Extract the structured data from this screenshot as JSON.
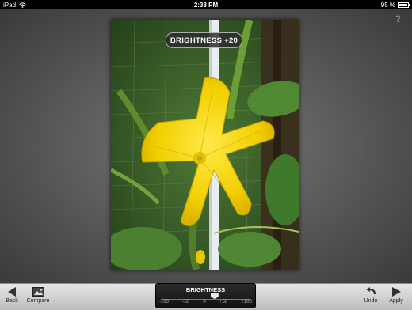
{
  "status_bar": {
    "device": "iPad",
    "time": "2:38 PM",
    "battery": "95 %"
  },
  "help": {
    "label": "?"
  },
  "photo": {
    "adjustment_badge": "BRIGHTNESS +20"
  },
  "toolbar": {
    "back_label": "Back",
    "compare_label": "Compare",
    "undo_label": "Undo",
    "apply_label": "Apply"
  },
  "slider": {
    "label": "BRIGHTNESS",
    "ticks": [
      "-100",
      "-50",
      "0",
      "+50",
      "+100"
    ],
    "value": 20,
    "min": -100,
    "max": 100
  },
  "colors": {
    "toolbar_bg": "#d4d4d4",
    "flower": "#f5d800",
    "foliage": "#3f6b25"
  }
}
